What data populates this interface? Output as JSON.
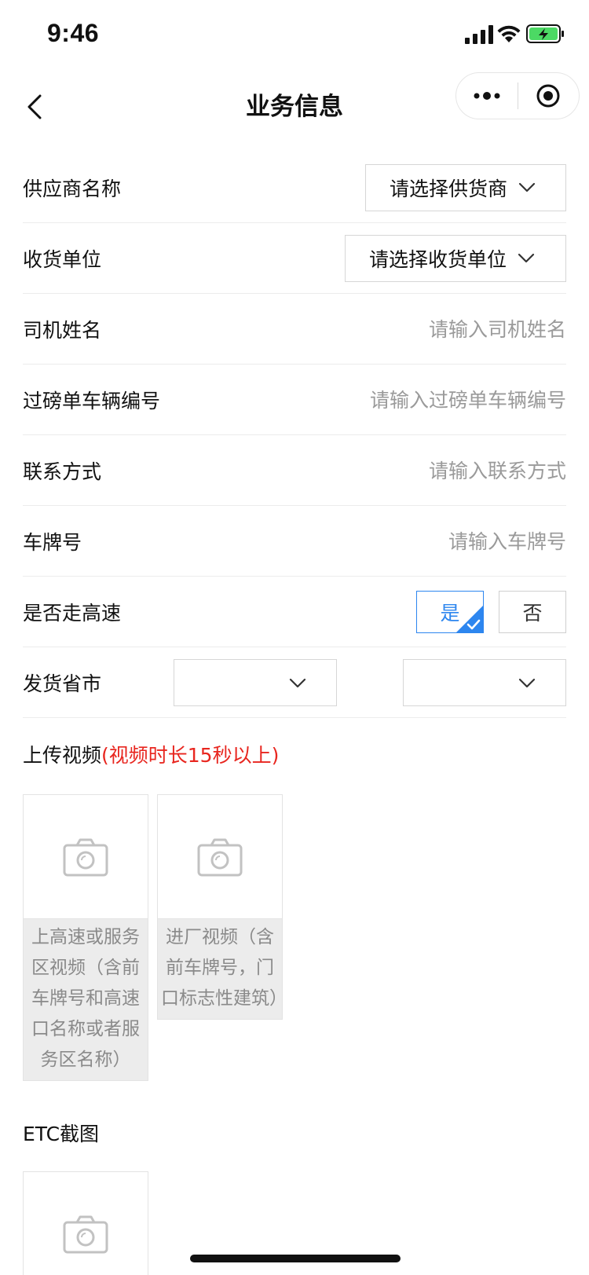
{
  "status_bar": {
    "time": "9:46",
    "icons": [
      "signal-icon",
      "wifi-icon",
      "battery-charging-icon"
    ],
    "battery_color": "#4cd964"
  },
  "nav": {
    "title": "业务信息",
    "back_icon": "chevron-left-icon",
    "capsule_icons": [
      "more-dots-icon",
      "record-target-icon"
    ]
  },
  "form": {
    "supplier": {
      "label": "供应商名称",
      "value": "请选择供货商"
    },
    "receiver": {
      "label": "收货单位",
      "value": "请选择收货单位"
    },
    "driver_name": {
      "label": "司机姓名",
      "placeholder": "请输入司机姓名"
    },
    "weigh_vehicle_no": {
      "label": "过磅单车辆编号",
      "placeholder": "请输入过磅单车辆编号"
    },
    "contact": {
      "label": "联系方式",
      "placeholder": "请输入联系方式"
    },
    "plate_no": {
      "label": "车牌号",
      "placeholder": "请输入车牌号"
    },
    "highway": {
      "label": "是否走高速",
      "yes_label": "是",
      "no_label": "否",
      "selected": "是"
    },
    "origin": {
      "label": "发货省市",
      "province": "",
      "city": ""
    }
  },
  "upload_video": {
    "title": "上传视频",
    "note": "(视频时长15秒以上)",
    "cards": [
      {
        "caption": "上高速或服务区视频（含前车牌号和高速口名称或者服务区名称）",
        "icon": "camera-icon"
      },
      {
        "caption": "进厂视频（含前车牌号，门口标志性建筑）",
        "icon": "camera-icon"
      }
    ]
  },
  "etc": {
    "title": "ETC截图",
    "icon": "camera-icon"
  },
  "colors": {
    "accent": "#2d86ef",
    "note_red": "#e8261f",
    "placeholder": "#9a9a9a",
    "border": "#d6d6d6"
  }
}
